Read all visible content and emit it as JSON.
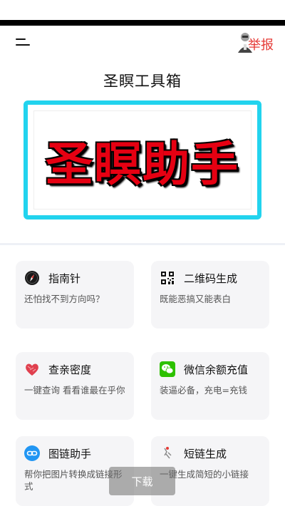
{
  "header": {
    "report_label": "举报",
    "page_title": "圣瞑工具箱"
  },
  "banner": {
    "text": "圣瞑助手",
    "border_color": "#22d3ee",
    "text_color": "#e60012"
  },
  "tools": [
    {
      "title": "指南针",
      "desc": "还怕找不到方向吗？",
      "icon": "compass-icon"
    },
    {
      "title": "二维码生成",
      "desc": "既能恶搞又能表白",
      "icon": "qrcode-icon"
    },
    {
      "title": "查亲密度",
      "desc": "一键查询 看看谁最在乎你",
      "icon": "heart-icon"
    },
    {
      "title": "微信余额充值",
      "desc": "装逼必备，充电=充钱",
      "icon": "wechat-icon"
    },
    {
      "title": "图链助手",
      "desc": "帮你把图片转换成链接形式",
      "icon": "link-icon"
    },
    {
      "title": "短链生成",
      "desc": "一键生成简短的小链接",
      "icon": "shortlink-icon"
    }
  ],
  "download_label": "下载"
}
